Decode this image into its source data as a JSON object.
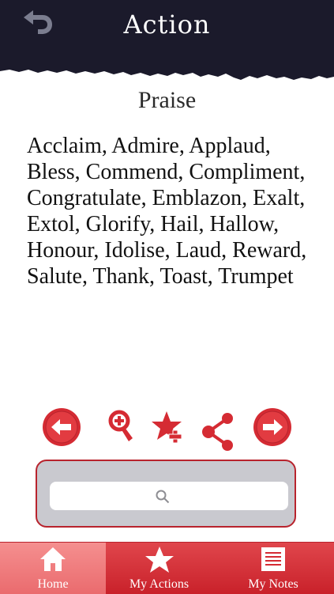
{
  "header": {
    "title": "Action"
  },
  "entry": {
    "word": "Praise",
    "synonyms": "Acclaim, Admire, Applaud, Bless, Commend, Compliment, Congratulate, Emblazon, Exalt, Extol, Glorify, Hail, Hallow, Honour, Idolise, Laud, Reward, Salute, Thank, Toast, Trumpet"
  },
  "search": {
    "placeholder": "",
    "value": ""
  },
  "tabs": [
    {
      "label": "Home",
      "icon": "home-icon",
      "active": true
    },
    {
      "label": "My Actions",
      "icon": "star-icon",
      "active": false
    },
    {
      "label": "My Notes",
      "icon": "notes-icon",
      "active": false
    }
  ],
  "colors": {
    "header_bg": "#1b1a2b",
    "accent_red": "#d52b33",
    "tab_active": "#ee7b7d",
    "search_bg": "#c9c9cf"
  }
}
